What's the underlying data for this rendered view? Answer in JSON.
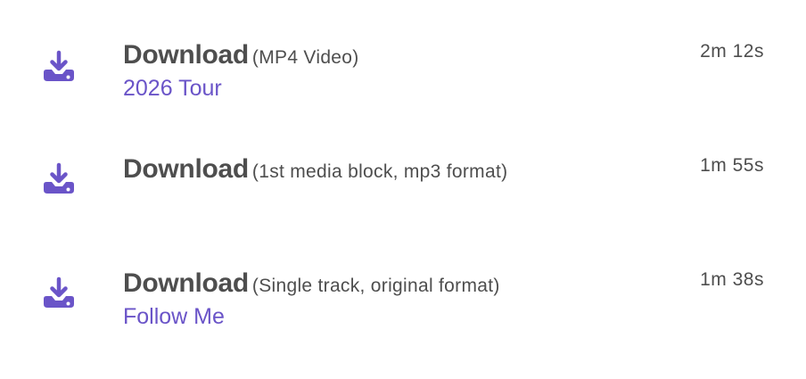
{
  "accent_color": "#6a54c8",
  "downloads": [
    {
      "icon": "download-icon",
      "label": "Download",
      "format": "(MP4 Video)",
      "link": "2026 Tour",
      "duration": "2m 12s"
    },
    {
      "icon": "download-icon",
      "label": "Download",
      "format": "(1st media block, mp3 format)",
      "link": "",
      "duration": "1m 55s"
    },
    {
      "icon": "download-icon",
      "label": "Download",
      "format": "(Single track, original format)",
      "link": "Follow Me",
      "duration": "1m 38s"
    }
  ]
}
